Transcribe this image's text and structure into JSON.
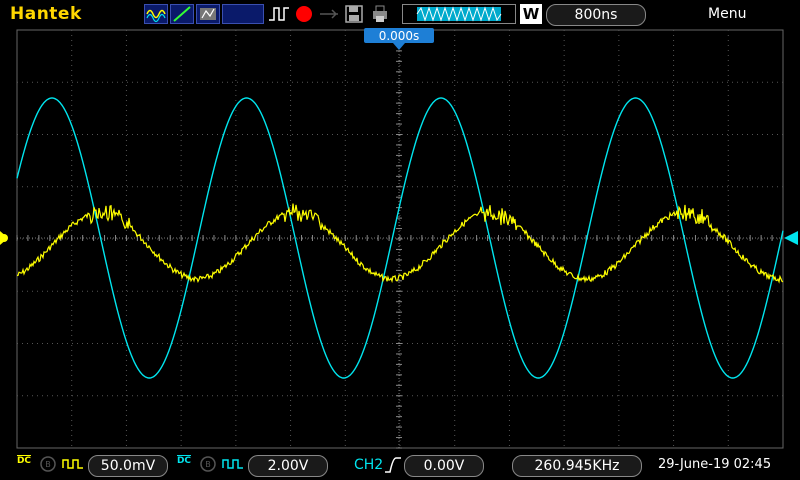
{
  "header": {
    "brand": "Hantek",
    "timebase": "800ns",
    "trigger_mode_letter": "W",
    "menu_label": "Menu",
    "trigger_position": "0.000s"
  },
  "ch1": {
    "coupling": "DC",
    "scale": "50.0mV",
    "color": "#ffff00"
  },
  "ch2": {
    "coupling": "DC",
    "scale": "2.00V",
    "color": "#00e5ee"
  },
  "trigger": {
    "source": "CH2",
    "level": "0.00V"
  },
  "frequency": "260.945KHz",
  "datetime": "29-June-19 02:45",
  "icons": {
    "wave_auto": "waveform-auto-icon",
    "line_draw": "vector-draw-icon",
    "persist": "persistence-icon",
    "trigger_edge": "rising-edge-icon",
    "run_stop": "record-icon",
    "usb": "usb-icon",
    "save": "save-icon",
    "print": "print-icon"
  }
}
